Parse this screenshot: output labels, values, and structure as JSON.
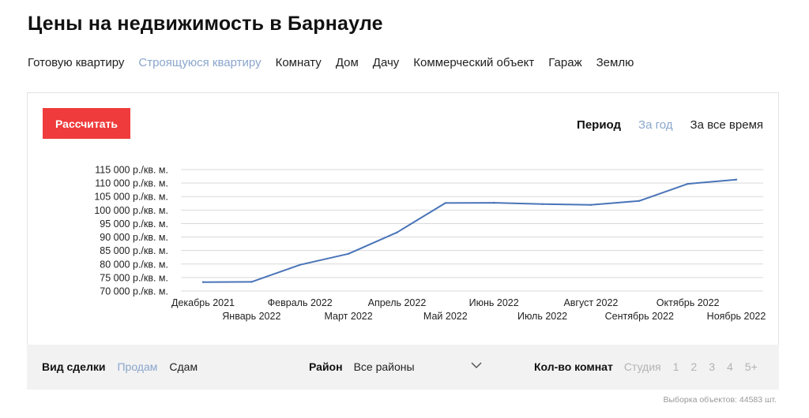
{
  "page": {
    "title": "Цены на недвижимость в Барнауле"
  },
  "property_types": [
    {
      "label": "Готовую квартиру",
      "active": false
    },
    {
      "label": "Строящуюся квартиру",
      "active": true
    },
    {
      "label": "Комнату",
      "active": false
    },
    {
      "label": "Дом",
      "active": false
    },
    {
      "label": "Дачу",
      "active": false
    },
    {
      "label": "Коммерческий объект",
      "active": false
    },
    {
      "label": "Гараж",
      "active": false
    },
    {
      "label": "Землю",
      "active": false
    }
  ],
  "toolbar": {
    "calculate_label": "Рассчитать"
  },
  "period": {
    "label": "Период",
    "options": [
      {
        "label": "За год",
        "active": true
      },
      {
        "label": "За все время",
        "active": false
      }
    ]
  },
  "colors": {
    "accent_red": "#ef3b3b",
    "active_link": "#8aa6cc",
    "series_line": "#4a74b8",
    "gridline": "#d9d9d9",
    "filter_bg": "#f2f2f2"
  },
  "chart_data": {
    "type": "line",
    "title": "",
    "xlabel": "",
    "ylabel": "",
    "ylim": [
      70000,
      115000
    ],
    "y_ticks": [
      115000,
      110000,
      105000,
      100000,
      95000,
      90000,
      85000,
      80000,
      75000,
      70000
    ],
    "y_tick_labels": [
      "115 000 р./кв. м.",
      "110 000 р./кв. м.",
      "105 000 р./кв. м.",
      "100 000 р./кв. м.",
      "95 000 р./кв. м.",
      "90 000 р./кв. м.",
      "85 000 р./кв. м.",
      "80 000 р./кв. м.",
      "75 000 р./кв. м.",
      "70 000 р./кв. м."
    ],
    "categories": [
      "Декабрь 2021",
      "Январь 2022",
      "Февраль 2022",
      "Март 2022",
      "Апрель 2022",
      "Май 2022",
      "Июнь 2022",
      "Июль 2022",
      "Август 2022",
      "Сентябрь 2022",
      "Октябрь 2022",
      "Ноябрь 2022"
    ],
    "series": [
      {
        "values": [
          73300,
          73400,
          79700,
          83800,
          91700,
          102600,
          102700,
          102200,
          101900,
          103400,
          109700,
          111300
        ]
      }
    ],
    "grid": true,
    "legend": "none"
  },
  "filters": {
    "deal": {
      "label": "Вид сделки",
      "options": [
        {
          "label": "Продам",
          "active": true
        },
        {
          "label": "Сдам",
          "active": false
        }
      ]
    },
    "district": {
      "label": "Район",
      "value": "Все районы",
      "icon": "chevron-down-icon"
    },
    "rooms": {
      "label": "Кол-во комнат",
      "options": [
        "Студия",
        "1",
        "2",
        "3",
        "4",
        "5+"
      ]
    }
  },
  "footer": {
    "selection_count": "Выборка объектов: 44583 шт."
  }
}
